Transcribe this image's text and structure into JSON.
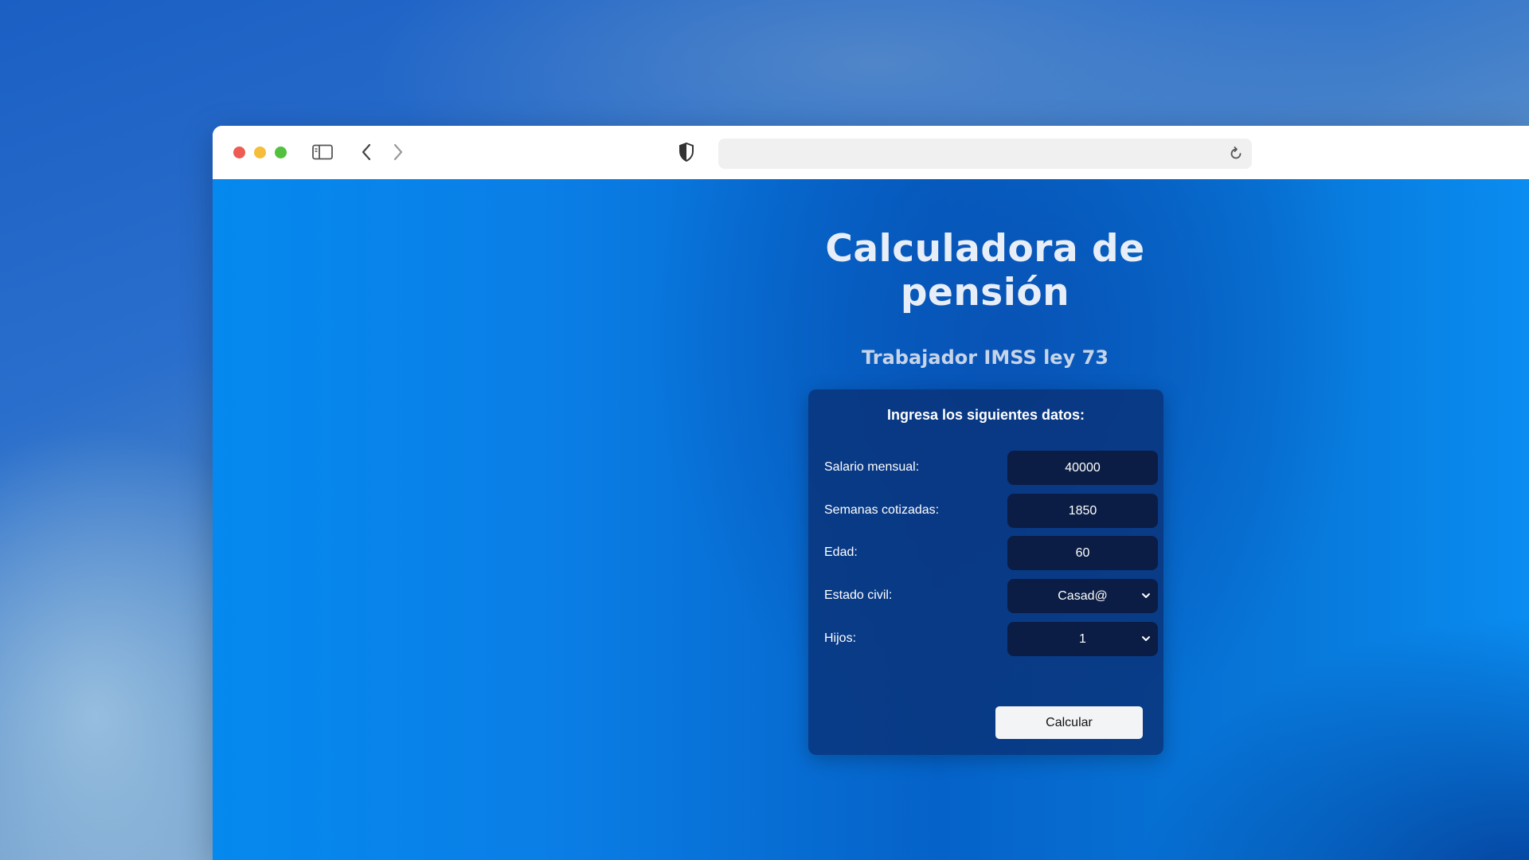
{
  "browser": {
    "address_value": "",
    "icons": [
      "sidebar-icon",
      "back-icon",
      "forward-icon",
      "shield-icon",
      "reload-icon"
    ]
  },
  "page": {
    "title": "Calculadora de pensión",
    "subtitle": "Trabajador IMSS ley 73"
  },
  "form": {
    "heading": "Ingresa los siguientes datos:",
    "salario": {
      "label": "Salario mensual:",
      "value": "40000"
    },
    "semanas": {
      "label": "Semanas cotizadas:",
      "value": "1850"
    },
    "edad": {
      "label": "Edad:",
      "value": "60"
    },
    "estado_civil": {
      "label": "Estado civil:",
      "value": "Casad@"
    },
    "hijos": {
      "label": "Hijos:",
      "value": "1"
    },
    "submit_label": "Calcular"
  },
  "colors": {
    "page_bg": "#0a7fe6",
    "card_bg": "#0a3278",
    "field_bg": "#0b1d44",
    "button_bg": "#f3f4f6"
  }
}
